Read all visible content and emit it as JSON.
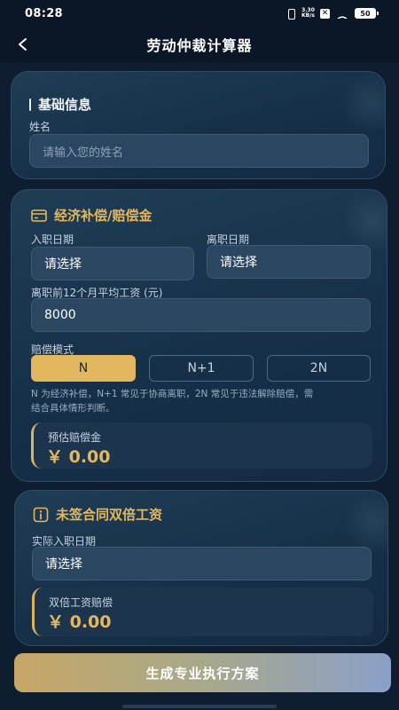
{
  "status": {
    "time": "08:28",
    "net_speed_top": "3.30",
    "net_speed_bottom": "KB/s",
    "notif": "✕",
    "battery": "50"
  },
  "header": {
    "title": "劳动仲裁计算器"
  },
  "basic": {
    "title": "基础信息",
    "name_label": "姓名",
    "name_placeholder": "请输入您的姓名"
  },
  "compensation": {
    "title": "经济补偿/赔偿金",
    "entry_label": "入职日期",
    "entry_value": "请选择",
    "leave_label": "离职日期",
    "leave_value": "请选择",
    "salary_label": "离职前12个月平均工资 (元)",
    "salary_value": "8000",
    "mode_label": "赔偿模式",
    "modes": [
      "N",
      "N+1",
      "2N"
    ],
    "selected_mode": "N",
    "hint_line1": "N 为经济补偿，N+1 常见于协商离职，2N 常见于违法解除赔偿，需",
    "hint_line2": "结合具体情形判断。",
    "result_label": "预估赔偿金",
    "result_value": "￥ 0.00"
  },
  "double_wage": {
    "title": "未签合同双倍工资",
    "entry_label": "实际入职日期",
    "entry_value": "请选择",
    "result_label": "双倍工资赔偿",
    "result_value": "￥ 0.00"
  },
  "cta": {
    "label": "生成专业执行方案"
  },
  "colors": {
    "accent_gold": "#e3b85f",
    "background": "#0f1d30",
    "card": "#1a3550"
  }
}
